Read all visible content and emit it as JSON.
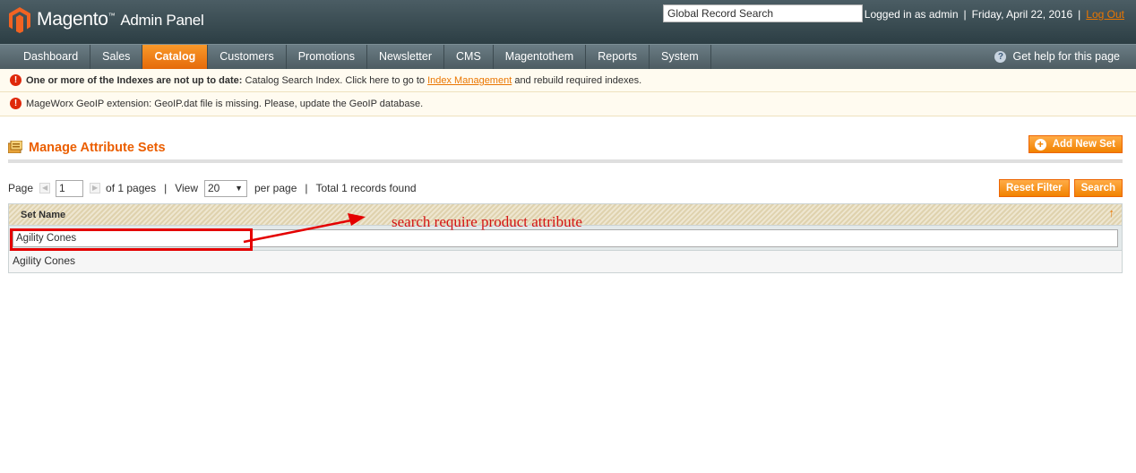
{
  "header": {
    "brand": "Magento",
    "brand_suffix": "Admin Panel",
    "search_value": "Global Record Search",
    "logged_in": "Logged in as admin",
    "date": "Friday, April 22, 2016",
    "logout": "Log Out"
  },
  "nav": {
    "items": [
      {
        "label": "Dashboard"
      },
      {
        "label": "Sales"
      },
      {
        "label": "Catalog"
      },
      {
        "label": "Customers"
      },
      {
        "label": "Promotions"
      },
      {
        "label": "Newsletter"
      },
      {
        "label": "CMS"
      },
      {
        "label": "Magentothem"
      },
      {
        "label": "Reports"
      },
      {
        "label": "System"
      }
    ],
    "active": "Catalog",
    "help": "Get help for this page"
  },
  "messages": {
    "index_bold": "One or more of the Indexes are not up to date:",
    "index_text": " Catalog Search Index. Click here to go to ",
    "index_link": "Index Management",
    "index_tail": " and rebuild required indexes.",
    "geoip": "MageWorx GeoIP extension: GeoIP.dat file is missing. Please, update the GeoIP database."
  },
  "page": {
    "title": "Manage Attribute Sets",
    "add_button": "Add New Set"
  },
  "pager": {
    "page_label": "Page",
    "page_value": "1",
    "of_pages": "of 1 pages",
    "sep": "|",
    "view_label": "View",
    "view_value": "20",
    "per_page": "per page",
    "total": "Total 1 records found",
    "reset_button": "Reset Filter",
    "search_button": "Search"
  },
  "grid": {
    "column": "Set Name",
    "filter_value": "Agility Cones",
    "rows": [
      {
        "name": "Agility Cones"
      }
    ]
  },
  "annotation": {
    "text": "search require product attribute",
    "color": "#d41414"
  },
  "colors": {
    "accent": "#eb5e00",
    "button": "#f18200",
    "header": "#2c3e44"
  }
}
